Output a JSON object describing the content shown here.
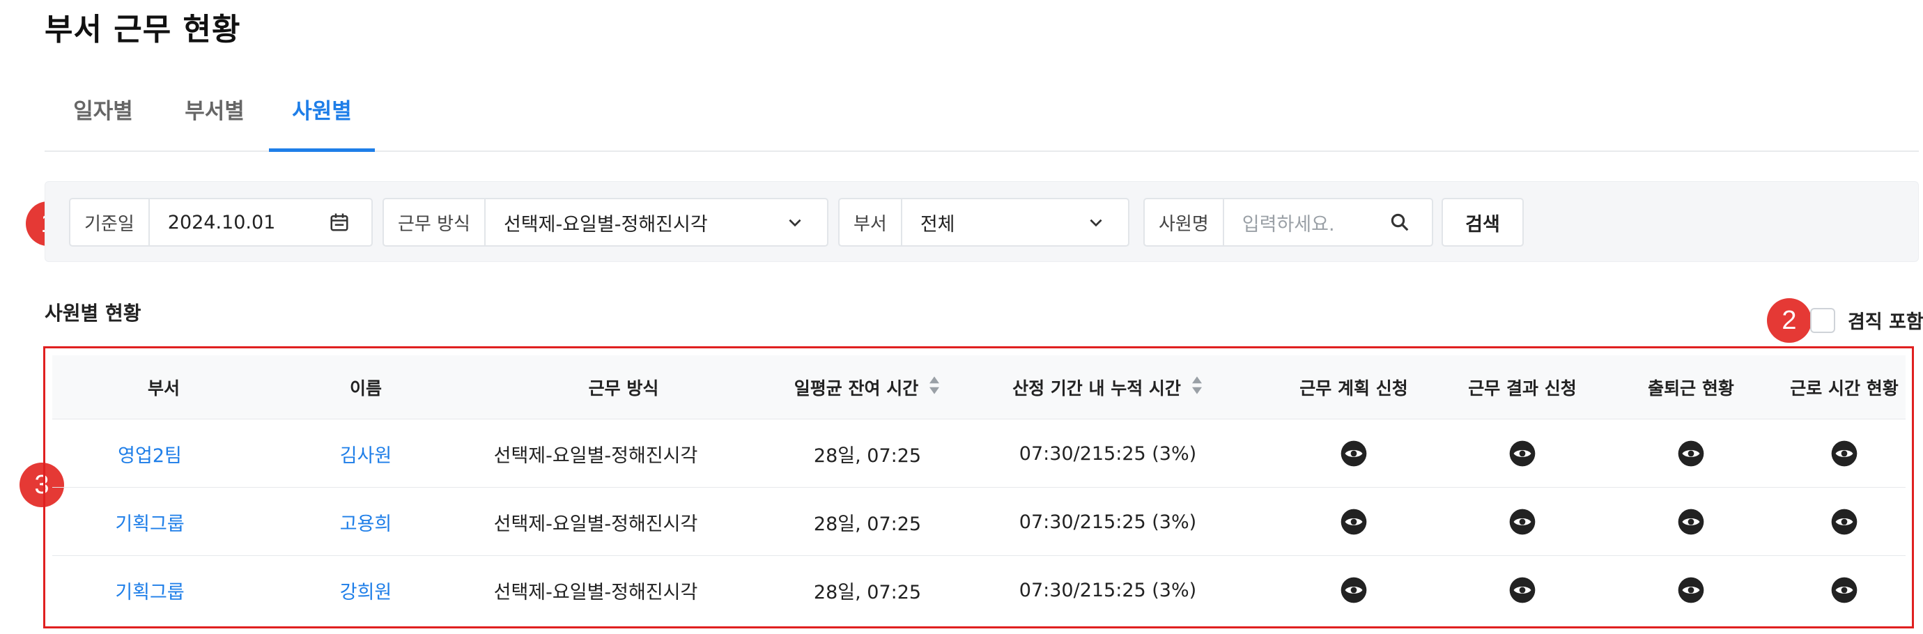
{
  "page": {
    "title": "부서 근무 현황"
  },
  "tabs": [
    {
      "label": "일자별",
      "active": false
    },
    {
      "label": "부서별",
      "active": false
    },
    {
      "label": "사원별",
      "active": true
    }
  ],
  "filters": {
    "date": {
      "label": "기준일",
      "value": "2024.10.01",
      "icon": "calendar-icon"
    },
    "work_type": {
      "label": "근무 방식",
      "value": "선택제-요일별-정해진시각",
      "icon": "chevron-down-icon"
    },
    "department": {
      "label": "부서",
      "value": "전체",
      "icon": "chevron-down-icon"
    },
    "employee": {
      "label": "사원명",
      "placeholder": "입력하세요.",
      "value": "",
      "icon": "search-icon"
    },
    "search_label": "검색"
  },
  "section": {
    "title": "사원별 현황"
  },
  "retire_toggle": {
    "label": "겸직 포함",
    "checked": false
  },
  "badges": [
    "1",
    "2",
    "3"
  ],
  "table": {
    "columns": [
      "부서",
      "이름",
      "근무 방식",
      "일평균 잔여 시간",
      "산정 기간 내 누적 시간",
      "근무 계획 신청",
      "근무 결과 신청",
      "출퇴근 현황",
      "근로 시간 현황"
    ],
    "rows": [
      {
        "dept": "영업2팀",
        "name": "김사원",
        "work_type": "선택제-요일별-정해진시각",
        "avg_remaining": "28일, 07:25",
        "accumulated": "07:30/215:25 (3%)"
      },
      {
        "dept": "기획그룹",
        "name": "고용희",
        "work_type": "선택제-요일별-정해진시각",
        "avg_remaining": "28일, 07:25",
        "accumulated": "07:30/215:25 (3%)"
      },
      {
        "dept": "기획그룹",
        "name": "강희원",
        "work_type": "선택제-요일별-정해진시각",
        "avg_remaining": "28일, 07:25",
        "accumulated": "07:30/215:25 (3%)"
      }
    ]
  },
  "colors": {
    "accent": "#1e7ee8",
    "badge": "#e53935",
    "highlight_border": "#e02020"
  }
}
